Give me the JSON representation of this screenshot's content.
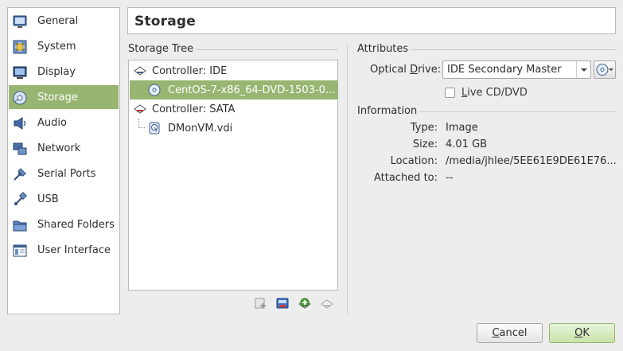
{
  "nav": {
    "items": [
      {
        "label": "General",
        "icon": "general-icon"
      },
      {
        "label": "System",
        "icon": "system-chip-icon"
      },
      {
        "label": "Display",
        "icon": "display-monitor-icon"
      },
      {
        "label": "Storage",
        "icon": "storage-disk-icon",
        "selected": true
      },
      {
        "label": "Audio",
        "icon": "audio-speaker-icon"
      },
      {
        "label": "Network",
        "icon": "network-icon"
      },
      {
        "label": "Serial Ports",
        "icon": "serial-port-icon"
      },
      {
        "label": "USB",
        "icon": "usb-icon"
      },
      {
        "label": "Shared Folders",
        "icon": "shared-folder-icon"
      },
      {
        "label": "User Interface",
        "icon": "user-interface-icon"
      }
    ]
  },
  "page": {
    "title": "Storage"
  },
  "storage_tree": {
    "label": "Storage Tree",
    "rows": [
      {
        "label": "Controller: IDE",
        "kind": "controller",
        "icon": "ide-controller-icon"
      },
      {
        "label": "CentOS-7-x86_64-DVD-1503-0...",
        "kind": "attachment",
        "icon": "optical-disc-icon",
        "selected": true
      },
      {
        "label": "Controller: SATA",
        "kind": "controller",
        "icon": "sata-controller-icon"
      },
      {
        "label": "DMonVM.vdi",
        "kind": "attachment",
        "icon": "hard-disk-icon"
      }
    ],
    "tools": [
      "remove-attachment-icon",
      "add-hard-disk-icon",
      "add-controller-icon",
      "remove-controller-icon"
    ]
  },
  "attributes": {
    "label": "Attributes",
    "optical_drive_label_pre": "Optical ",
    "optical_drive_label_key": "D",
    "optical_drive_label_post": "rive:",
    "optical_drive_value": "IDE Secondary Master",
    "live_cd_label_key": "L",
    "live_cd_label_post": "ive CD/DVD",
    "live_cd_checked": false
  },
  "information": {
    "label": "Information",
    "rows": [
      {
        "key": "Type:",
        "value": "Image"
      },
      {
        "key": "Size:",
        "value": "4.01 GB"
      },
      {
        "key": "Location:",
        "value": "/media/jhlee/5EE61E9DE61E76..."
      },
      {
        "key": "Attached to:",
        "value": "--"
      }
    ]
  },
  "buttons": {
    "cancel_key": "C",
    "cancel_rest": "ancel",
    "ok_key": "O",
    "ok_rest": "K"
  },
  "colors": {
    "selection": "#98b571",
    "ok_button": "#c8e3aa"
  }
}
